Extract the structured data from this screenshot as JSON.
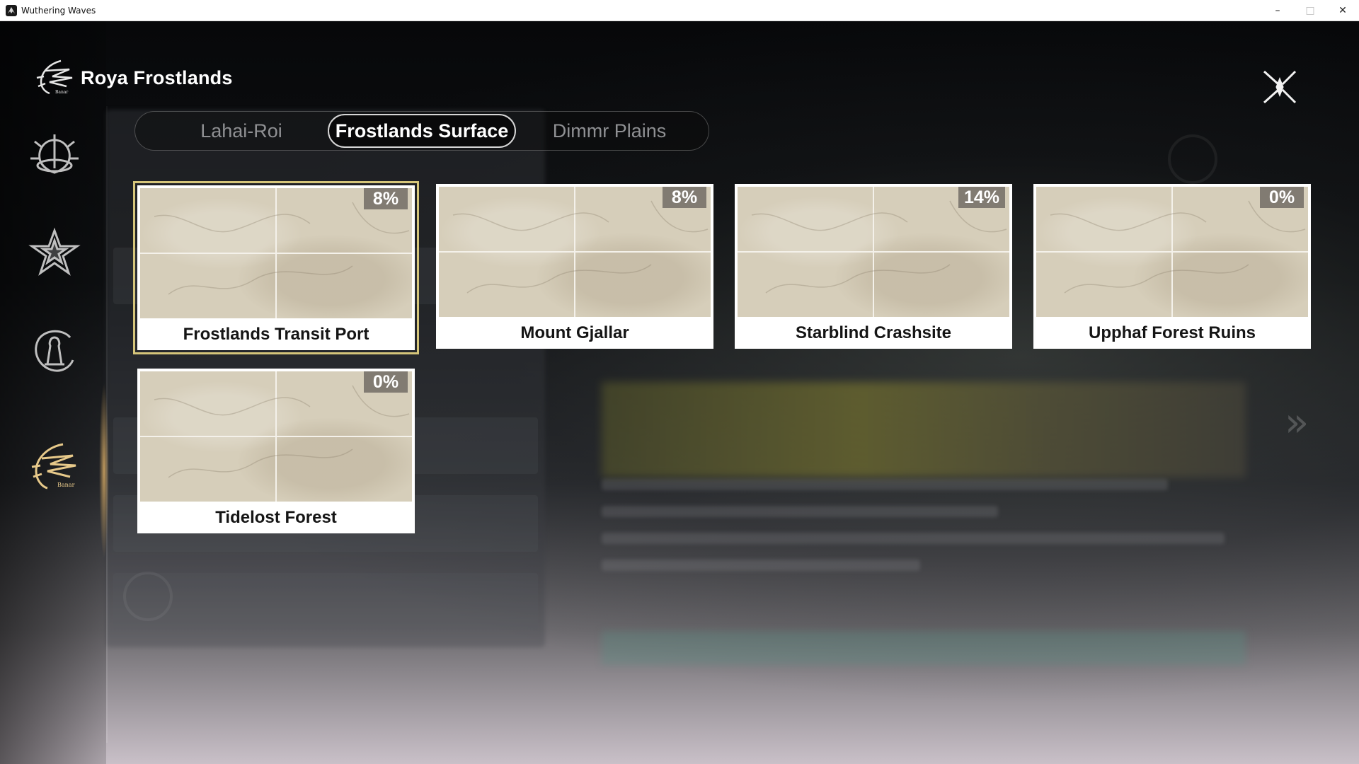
{
  "window": {
    "title": "Wuthering Waves",
    "app_icon": "wuthering-waves-icon",
    "controls": [
      "minimize-icon",
      "maximize-icon",
      "close-icon"
    ]
  },
  "header": {
    "region_title": "Roya Frostlands",
    "logo_icon": "region-emblem-icon",
    "close_icon": "close-x-icon"
  },
  "tabs": [
    {
      "label": "Lahai-Roi",
      "active": false
    },
    {
      "label": "Frostlands Surface",
      "active": true
    },
    {
      "label": "Dimmr Plains",
      "active": false
    }
  ],
  "sidebar": {
    "items": [
      {
        "icon": "dragon-emblem-icon",
        "active": false
      },
      {
        "icon": "star-emblem-icon",
        "active": false
      },
      {
        "icon": "goddess-emblem-icon",
        "active": false
      },
      {
        "icon": "region-emblem-icon",
        "active": true
      }
    ]
  },
  "areas": [
    {
      "name": "Frostlands Transit Port",
      "progress": "8%",
      "selected": true
    },
    {
      "name": "Mount Gjallar",
      "progress": "8%",
      "selected": false
    },
    {
      "name": "Starblind Crashsite",
      "progress": "14%",
      "selected": false
    },
    {
      "name": "Upphaf Forest Ruins",
      "progress": "0%",
      "selected": false
    },
    {
      "name": "Tidelost Forest",
      "progress": "0%",
      "selected": false
    }
  ],
  "colors": {
    "selected_outline": "#d5c57a",
    "card_map": "#d6ceba",
    "badge_bg": "#6e6962"
  }
}
